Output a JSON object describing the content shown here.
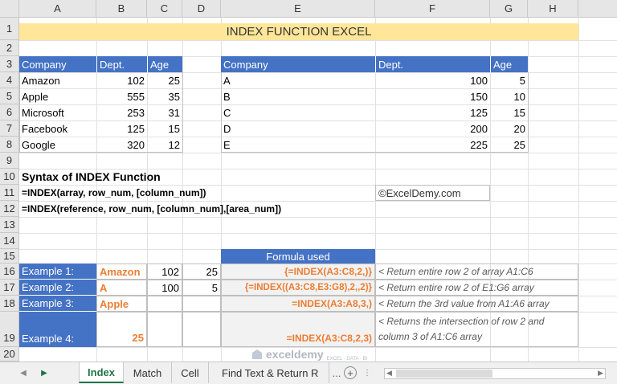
{
  "columns": [
    "A",
    "B",
    "C",
    "D",
    "E",
    "F",
    "G",
    "H"
  ],
  "rows": [
    "1",
    "2",
    "3",
    "4",
    "5",
    "6",
    "7",
    "8",
    "9",
    "10",
    "11",
    "12",
    "13",
    "14",
    "15",
    "16",
    "17",
    "18",
    "19",
    "20"
  ],
  "title": "INDEX FUNCTION EXCEL",
  "table1": {
    "headers": [
      "Company",
      "Dept.",
      "Age"
    ],
    "rows": [
      [
        "Amazon",
        "102",
        "25"
      ],
      [
        "Apple",
        "555",
        "35"
      ],
      [
        "Microsoft",
        "253",
        "31"
      ],
      [
        "Facebook",
        "125",
        "15"
      ],
      [
        "Google",
        "320",
        "12"
      ]
    ]
  },
  "table2": {
    "headers": [
      "Company",
      "Dept.",
      "Age"
    ],
    "rows": [
      [
        "A",
        "100",
        "5"
      ],
      [
        "B",
        "150",
        "10"
      ],
      [
        "C",
        "125",
        "15"
      ],
      [
        "D",
        "200",
        "20"
      ],
      [
        "E",
        "225",
        "25"
      ]
    ]
  },
  "syntax": {
    "heading": "Syntax of INDEX Function",
    "line1": "=INDEX(array, row_num, [column_num])",
    "line2": "=INDEX(reference, row_num, [column_num],[area_num])",
    "brand": "©ExcelDemy.com"
  },
  "examples": {
    "formula_header": "Formula used",
    "rows": [
      {
        "label": "Example 1:",
        "b": "Amazon",
        "c": "102",
        "d": "25",
        "formula": "{=INDEX(A3:C8,2,)}",
        "note": "< Return entire row 2 of array A1:C6"
      },
      {
        "label": "Example 2:",
        "b": "A",
        "c": "100",
        "d": "5",
        "formula": "{=INDEX((A3:C8,E3:G8),2,,2)}",
        "note": "< Return entire row 2 of E1:G6 array"
      },
      {
        "label": "Example 3:",
        "b": "Apple",
        "c": "",
        "d": "",
        "formula": "=INDEX(A3:A8,3,)",
        "note": "< Return the 3rd value from A1:A6 array"
      },
      {
        "label": "Example 4:",
        "b": "25",
        "c": "",
        "d": "",
        "formula": "=INDEX(A3:C8,2,3)",
        "note1": "< Returns the intersection of row 2 and",
        "note2": "column 3 of A1:C6 array"
      }
    ]
  },
  "watermark": {
    "name": "exceldemy",
    "tagline": "EXCEL · DATA · BI"
  },
  "tabs": [
    "Index",
    "Match",
    "Cell",
    "Find Text & Return R"
  ],
  "more_tabs": "...",
  "add_sheet": "+"
}
